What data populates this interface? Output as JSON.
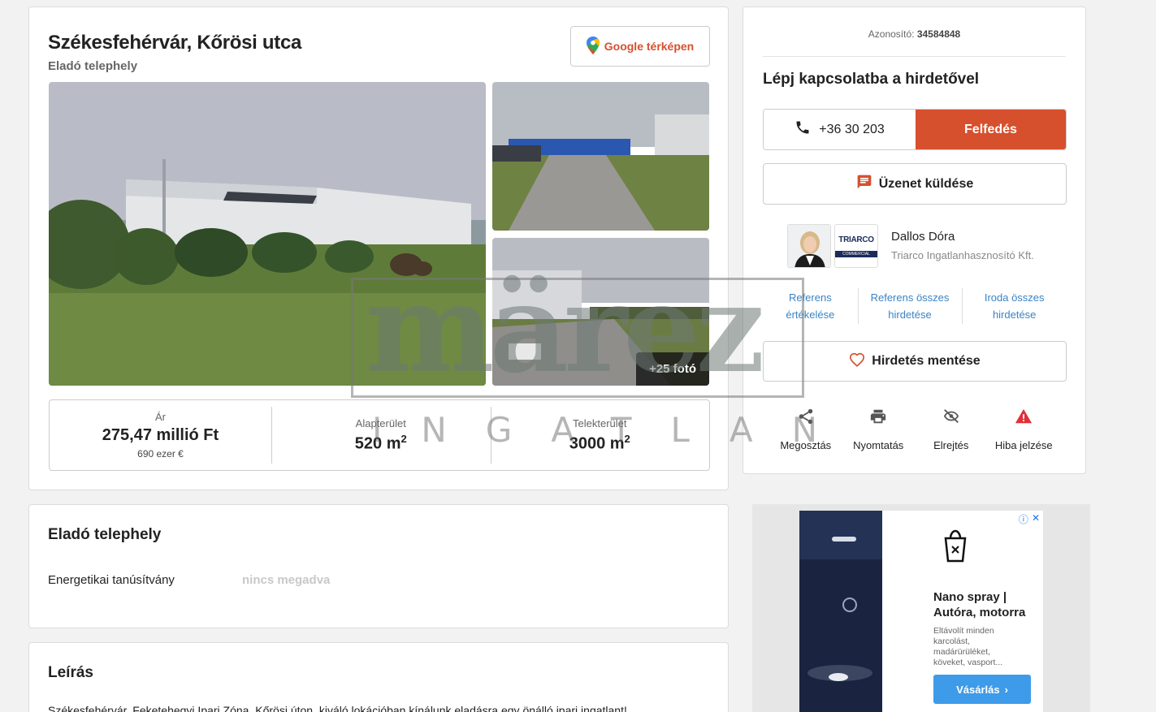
{
  "listing": {
    "title": "Székesfehérvár, Kőrösi utca",
    "subtitle": "Eladó telephely",
    "map_button": "Google térképen",
    "more_photos": "+25 fotó",
    "stats": {
      "price_label": "Ár",
      "price_value": "275,47 millió Ft",
      "price_eur": "690 ezer €",
      "area_label": "Alapterület",
      "area_value": "520 m",
      "area_unit_sup": "2",
      "plot_label": "Telekterület",
      "plot_value": "3000 m",
      "plot_unit_sup": "2"
    }
  },
  "details": {
    "title": "Eladó telephely",
    "energy_label": "Energetikai tanúsítvány",
    "energy_value": "nincs megadva"
  },
  "description": {
    "title": "Leírás",
    "text": "Székesfehérvár, Feketehegyi Ipari Zóna, Kőrösi úton, kiváló lokációban kínálunk eladásra egy önálló ipari ingatlant!"
  },
  "contact": {
    "id_label": "Azonosító:",
    "id_value": "34584848",
    "title": "Lépj kapcsolatba a hirdetővel",
    "phone": "+36 30 203",
    "reveal_button": "Felfedés",
    "message_button": "Üzenet küldése",
    "agent_name": "Dallos Dóra",
    "agent_company": "Triarco Ingatlanhasznosító Kft.",
    "agency_logo_text": "TRIARCO",
    "agency_logo_sub": "COMMERCIAL",
    "links": [
      "Referens értékelése",
      "Referens összes hirdetése",
      "Iroda összes hirdetése"
    ],
    "save_button": "Hirdetés mentése",
    "actions": [
      "Megosztás",
      "Nyomtatás",
      "Elrejtés",
      "Hiba jelzése"
    ]
  },
  "ad": {
    "title": "Nano spray | Autóra, motorra",
    "desc": "Eltávolít minden karcolást, madárürüléket, köveket, vasport...",
    "button": "Vásárlás"
  },
  "watermark": {
    "big": "märez",
    "small": "INGATLAN"
  },
  "colors": {
    "accent": "#d6502d",
    "link": "#3a84c4",
    "ad_button": "#3d9be9"
  }
}
